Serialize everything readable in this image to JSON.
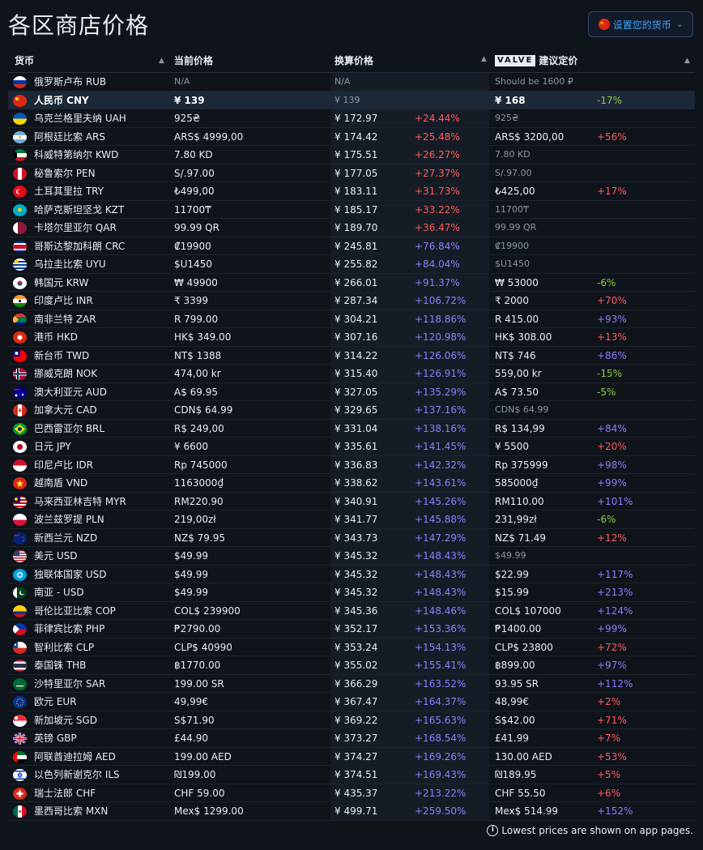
{
  "page": {
    "title": "各区商店价格"
  },
  "currency_button": {
    "label": "设置您的货币",
    "flag": "CN"
  },
  "headers": {
    "currency": "货币",
    "current_price": "当前价格",
    "converted_price": "换算价格",
    "valve_logo": "VALVE",
    "recommended": "建议定价"
  },
  "rows": [
    {
      "flag": "RU",
      "name": "俄罗斯卢布 RUB",
      "current": "N/A",
      "converted": "N/A",
      "pct": "",
      "rec": "Should be 1600 ₽",
      "rpct": "",
      "cur_muted": true,
      "conv_muted": true,
      "rec_muted": true
    },
    {
      "flag": "CN",
      "name": "人民币 CNY",
      "current": "¥ 139",
      "converted": "¥ 139",
      "pct": "",
      "rec": "¥ 168",
      "rpct": "-17%",
      "highlight": true,
      "conv_muted": true
    },
    {
      "flag": "UA",
      "name": "乌克兰格里夫纳 UAH",
      "current": "925₴",
      "converted": "¥ 172.97",
      "pct": "+24.44%",
      "rec": "925₴",
      "rpct": "",
      "rec_muted": true
    },
    {
      "flag": "AR",
      "name": "阿根廷比索 ARS",
      "current": "ARS$ 4999,00",
      "converted": "¥ 174.42",
      "pct": "+25.48%",
      "rec": "ARS$ 3200,00",
      "rpct": "+56%"
    },
    {
      "flag": "KW",
      "name": "科威特第纳尔 KWD",
      "current": "7.80 KD",
      "converted": "¥ 175.51",
      "pct": "+26.27%",
      "rec": "7.80 KD",
      "rpct": "",
      "rec_muted": true
    },
    {
      "flag": "PE",
      "name": "秘鲁索尔 PEN",
      "current": "S/.97.00",
      "converted": "¥ 177.05",
      "pct": "+27.37%",
      "rec": "S/.97.00",
      "rpct": "",
      "rec_muted": true
    },
    {
      "flag": "TR",
      "name": "土耳其里拉 TRY",
      "current": "₺499,00",
      "converted": "¥ 183.11",
      "pct": "+31.73%",
      "rec": "₺425,00",
      "rpct": "+17%"
    },
    {
      "flag": "KZ",
      "name": "哈萨克斯坦坚戈 KZT",
      "current": "11700₸",
      "converted": "¥ 185.17",
      "pct": "+33.22%",
      "rec": "11700₸",
      "rpct": "",
      "rec_muted": true
    },
    {
      "flag": "QA",
      "name": "卡塔尔里亚尔 QAR",
      "current": "99.99 QR",
      "converted": "¥ 189.70",
      "pct": "+36.47%",
      "rec": "99.99 QR",
      "rpct": "",
      "rec_muted": true
    },
    {
      "flag": "CR",
      "name": "哥斯达黎加科朗 CRC",
      "current": "₡19900",
      "converted": "¥ 245.81",
      "pct": "+76.84%",
      "rec": "₡19900",
      "rpct": "",
      "rec_muted": true
    },
    {
      "flag": "UY",
      "name": "乌拉圭比索 UYU",
      "current": "$U1450",
      "converted": "¥ 255.82",
      "pct": "+84.04%",
      "rec": "$U1450",
      "rpct": "",
      "rec_muted": true
    },
    {
      "flag": "KR",
      "name": "韩国元 KRW",
      "current": "₩ 49900",
      "converted": "¥ 266.01",
      "pct": "+91.37%",
      "rec": "₩ 53000",
      "rpct": "-6%"
    },
    {
      "flag": "IN",
      "name": "印度卢比 INR",
      "current": "₹ 3399",
      "converted": "¥ 287.34",
      "pct": "+106.72%",
      "rec": "₹ 2000",
      "rpct": "+70%"
    },
    {
      "flag": "ZA",
      "name": "南非兰特 ZAR",
      "current": "R 799.00",
      "converted": "¥ 304.21",
      "pct": "+118.86%",
      "rec": "R 415.00",
      "rpct": "+93%"
    },
    {
      "flag": "HK",
      "name": "港币 HKD",
      "current": "HK$ 349.00",
      "converted": "¥ 307.16",
      "pct": "+120.98%",
      "rec": "HK$ 308.00",
      "rpct": "+13%"
    },
    {
      "flag": "TW",
      "name": "新台币 TWD",
      "current": "NT$ 1388",
      "converted": "¥ 314.22",
      "pct": "+126.06%",
      "rec": "NT$ 746",
      "rpct": "+86%"
    },
    {
      "flag": "NO",
      "name": "挪威克朗 NOK",
      "current": "474,00 kr",
      "converted": "¥ 315.40",
      "pct": "+126.91%",
      "rec": "559,00 kr",
      "rpct": "-15%"
    },
    {
      "flag": "AU",
      "name": "澳大利亚元 AUD",
      "current": "A$ 69.95",
      "converted": "¥ 327.05",
      "pct": "+135.29%",
      "rec": "A$ 73.50",
      "rpct": "-5%"
    },
    {
      "flag": "CA",
      "name": "加拿大元 CAD",
      "current": "CDN$ 64.99",
      "converted": "¥ 329.65",
      "pct": "+137.16%",
      "rec": "CDN$ 64.99",
      "rpct": "",
      "rec_muted": true
    },
    {
      "flag": "BR",
      "name": "巴西雷亚尔 BRL",
      "current": "R$ 249,00",
      "converted": "¥ 331.04",
      "pct": "+138.16%",
      "rec": "R$ 134,99",
      "rpct": "+84%"
    },
    {
      "flag": "JP",
      "name": "日元 JPY",
      "current": "¥ 6600",
      "converted": "¥ 335.61",
      "pct": "+141.45%",
      "rec": "¥ 5500",
      "rpct": "+20%"
    },
    {
      "flag": "ID",
      "name": "印尼卢比 IDR",
      "current": "Rp 745000",
      "converted": "¥ 336.83",
      "pct": "+142.32%",
      "rec": "Rp 375999",
      "rpct": "+98%"
    },
    {
      "flag": "VN",
      "name": "越南盾 VND",
      "current": "1163000₫",
      "converted": "¥ 338.62",
      "pct": "+143.61%",
      "rec": "585000₫",
      "rpct": "+99%"
    },
    {
      "flag": "MY",
      "name": "马来西亚林吉特 MYR",
      "current": "RM220.90",
      "converted": "¥ 340.91",
      "pct": "+145.26%",
      "rec": "RM110.00",
      "rpct": "+101%"
    },
    {
      "flag": "PL",
      "name": "波兰兹罗提 PLN",
      "current": "219,00zł",
      "converted": "¥ 341.77",
      "pct": "+145.88%",
      "rec": "231,99zł",
      "rpct": "-6%"
    },
    {
      "flag": "NZ",
      "name": "新西兰元 NZD",
      "current": "NZ$ 79.95",
      "converted": "¥ 343.73",
      "pct": "+147.29%",
      "rec": "NZ$ 71.49",
      "rpct": "+12%"
    },
    {
      "flag": "US",
      "name": "美元 USD",
      "current": "$49.99",
      "converted": "¥ 345.32",
      "pct": "+148.43%",
      "rec": "$49.99",
      "rpct": "",
      "rec_muted": true
    },
    {
      "flag": "CIS",
      "name": "独联体国家 USD",
      "current": "$49.99",
      "converted": "¥ 345.32",
      "pct": "+148.43%",
      "rec": "$22.99",
      "rpct": "+117%"
    },
    {
      "flag": "PK",
      "name": "南亚 - USD",
      "current": "$49.99",
      "converted": "¥ 345.32",
      "pct": "+148.43%",
      "rec": "$15.99",
      "rpct": "+213%"
    },
    {
      "flag": "CO",
      "name": "哥伦比亚比索 COP",
      "current": "COL$ 239900",
      "converted": "¥ 345.36",
      "pct": "+148.46%",
      "rec": "COL$ 107000",
      "rpct": "+124%"
    },
    {
      "flag": "PH",
      "name": "菲律宾比索 PHP",
      "current": "₱2790.00",
      "converted": "¥ 352.17",
      "pct": "+153.36%",
      "rec": "₱1400.00",
      "rpct": "+99%"
    },
    {
      "flag": "CL",
      "name": "智利比索 CLP",
      "current": "CLP$ 40990",
      "converted": "¥ 353.24",
      "pct": "+154.13%",
      "rec": "CLP$ 23800",
      "rpct": "+72%"
    },
    {
      "flag": "TH",
      "name": "泰国铢 THB",
      "current": "฿1770.00",
      "converted": "¥ 355.02",
      "pct": "+155.41%",
      "rec": "฿899.00",
      "rpct": "+97%"
    },
    {
      "flag": "SA",
      "name": "沙特里亚尔 SAR",
      "current": "199.00 SR",
      "converted": "¥ 366.29",
      "pct": "+163.52%",
      "rec": "93.95 SR",
      "rpct": "+112%"
    },
    {
      "flag": "EU",
      "name": "欧元 EUR",
      "current": "49,99€",
      "converted": "¥ 367.47",
      "pct": "+164.37%",
      "rec": "48,99€",
      "rpct": "+2%"
    },
    {
      "flag": "SG",
      "name": "新加坡元 SGD",
      "current": "S$71.90",
      "converted": "¥ 369.22",
      "pct": "+165.63%",
      "rec": "S$42.00",
      "rpct": "+71%"
    },
    {
      "flag": "GB",
      "name": "英镑 GBP",
      "current": "£44.90",
      "converted": "¥ 373.27",
      "pct": "+168.54%",
      "rec": "£41.99",
      "rpct": "+7%"
    },
    {
      "flag": "AE",
      "name": "阿联酋迪拉姆 AED",
      "current": "199.00 AED",
      "converted": "¥ 374.27",
      "pct": "+169.26%",
      "rec": "130.00 AED",
      "rpct": "+53%"
    },
    {
      "flag": "IL",
      "name": "以色列新谢克尔 ILS",
      "current": "₪199.00",
      "converted": "¥ 374.51",
      "pct": "+169.43%",
      "rec": "₪189.95",
      "rpct": "+5%"
    },
    {
      "flag": "CH",
      "name": "瑞士法郎 CHF",
      "current": "CHF 59.00",
      "converted": "¥ 435.37",
      "pct": "+213.22%",
      "rec": "CHF 55.50",
      "rpct": "+6%"
    },
    {
      "flag": "MX",
      "name": "墨西哥比索 MXN",
      "current": "Mex$ 1299.00",
      "converted": "¥ 499.71",
      "pct": "+259.50%",
      "rec": "Mex$ 514.99",
      "rpct": "+152%"
    }
  ],
  "footer": {
    "note": "Lowest prices are shown on app pages."
  },
  "colors": {
    "positive_low": "#ff5b5b",
    "positive_high": "#8d7cff",
    "negative": "#8bcf3d",
    "accent": "#3ea8ff"
  }
}
